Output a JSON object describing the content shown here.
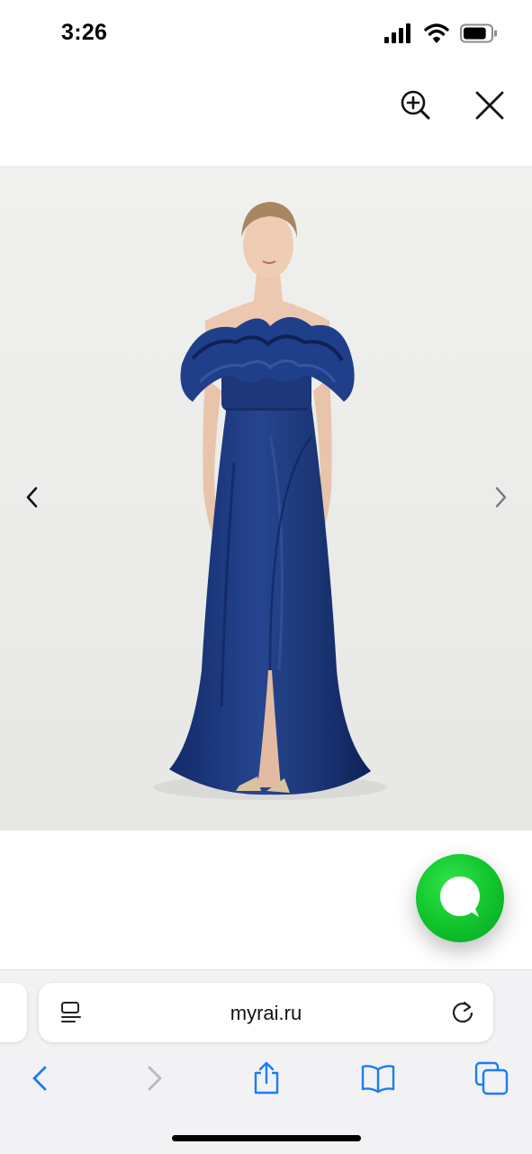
{
  "status_bar": {
    "time": "3:26",
    "battery_level": 0.85
  },
  "image_viewer": {
    "zoom_icon": "zoom-in-icon",
    "close_icon": "close-icon",
    "prev_icon": "chevron-left-icon",
    "next_icon": "chevron-right-icon",
    "photo": "model-in-navy-off-shoulder-ruffle-gown"
  },
  "chat_widget": {
    "icon": "chat-bubble-icon",
    "color": "#10c22c"
  },
  "browser": {
    "url": "myrai.ru",
    "accent": "#1a7cf5",
    "toolbar": [
      "back-icon",
      "forward-icon",
      "share-icon",
      "bookmarks-icon",
      "tabs-icon"
    ]
  }
}
